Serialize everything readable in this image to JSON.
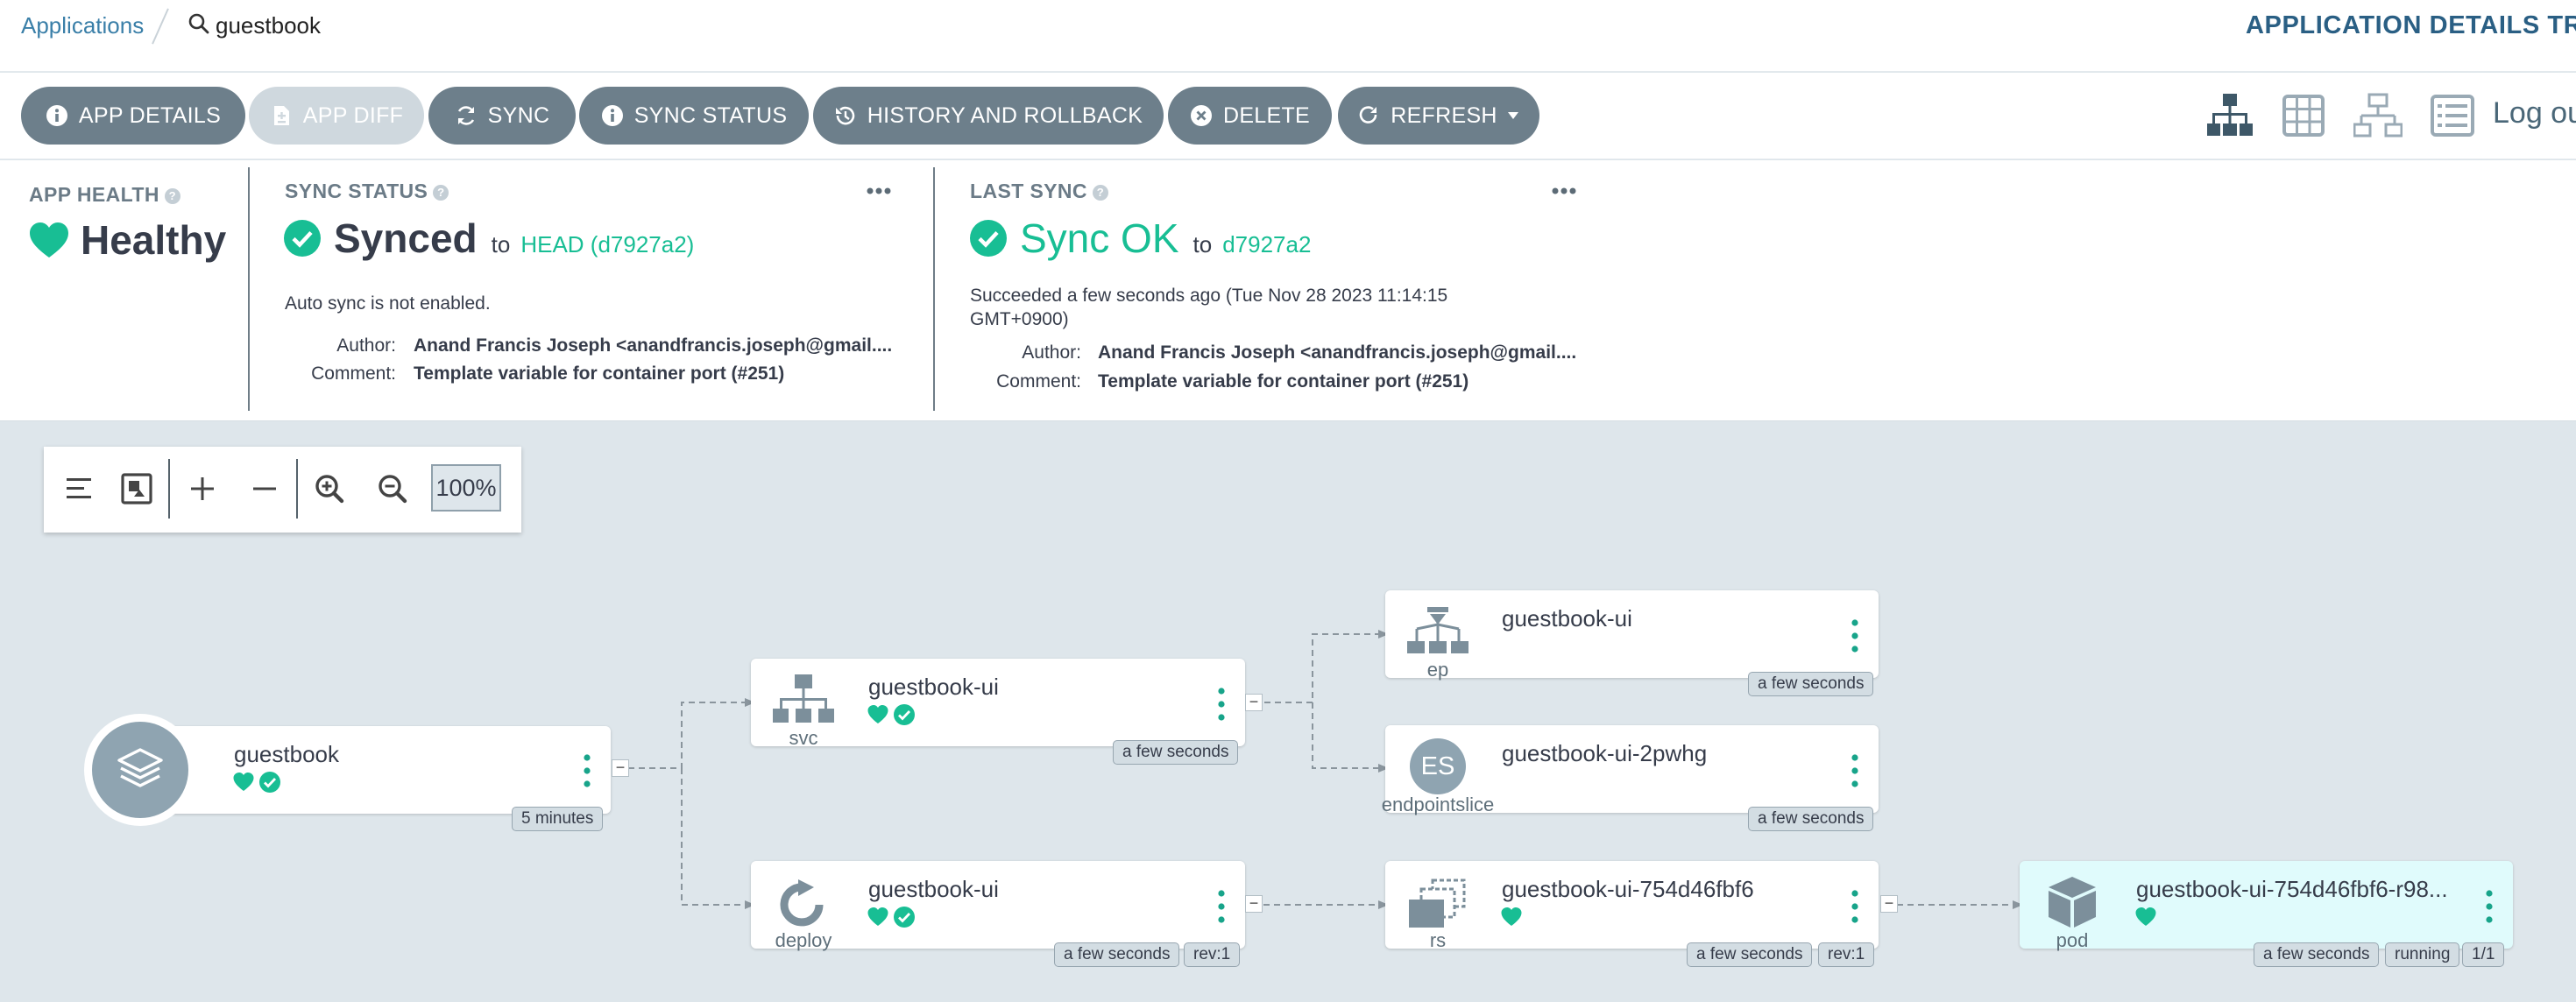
{
  "breadcrumb": {
    "parent": "Applications",
    "current": "guestbook"
  },
  "page_title": "APPLICATION DETAILS TREE",
  "toolbar": {
    "app_details": "APP DETAILS",
    "app_diff": "APP DIFF",
    "sync": "SYNC",
    "sync_status": "SYNC STATUS",
    "history": "HISTORY AND ROLLBACK",
    "delete": "DELETE",
    "refresh": "REFRESH",
    "logout": "Log out",
    "view_icons": [
      "tree-view-icon",
      "pods-grid-view-icon",
      "network-view-icon",
      "list-view-icon"
    ]
  },
  "status": {
    "app_health": {
      "title": "APP HEALTH",
      "value": "Healthy"
    },
    "sync_status": {
      "title": "SYNC STATUS",
      "value": "Synced",
      "to": "to",
      "revision": "HEAD (d7927a2)",
      "auto_sync": "Auto sync is not enabled.",
      "author_label": "Author:",
      "author": "Anand Francis Joseph <anandfrancis.joseph@gmail....",
      "comment_label": "Comment:",
      "comment": "Template variable for container port (#251)"
    },
    "last_sync": {
      "title": "LAST SYNC",
      "value": "Sync OK",
      "to": "to",
      "revision": "d7927a2",
      "succeeded_line1": "Succeeded a few seconds ago (Tue Nov 28 2023 11:14:15",
      "succeeded_line2": "GMT+0900)",
      "author_label": "Author:",
      "author": "Anand Francis Joseph <anandfrancis.joseph@gmail....",
      "comment_label": "Comment:",
      "comment": "Template variable for container port (#251)"
    }
  },
  "graph_toolbar": {
    "zoom": "100%"
  },
  "colors": {
    "healthy": "#18be94",
    "synced": "#18be94",
    "link": "#18be94",
    "button": "#6d7f8b",
    "title": "#2a5f84"
  },
  "nodes": {
    "app": {
      "name": "guestbook",
      "tags": [
        "5 minutes"
      ]
    },
    "svc": {
      "name": "guestbook-ui",
      "kind": "svc",
      "tags": [
        "a few seconds"
      ]
    },
    "deploy": {
      "name": "guestbook-ui",
      "kind": "deploy",
      "tags": [
        "a few seconds",
        "rev:1"
      ]
    },
    "ep": {
      "name": "guestbook-ui",
      "kind": "ep",
      "tags": [
        "a few seconds"
      ]
    },
    "endpointslice": {
      "name": "guestbook-ui-2pwhg",
      "kind": "endpointslice",
      "icon_text": "ES",
      "tags": [
        "a few seconds"
      ]
    },
    "rs": {
      "name": "guestbook-ui-754d46fbf6",
      "kind": "rs",
      "tags": [
        "a few seconds",
        "rev:1"
      ]
    },
    "pod": {
      "name": "guestbook-ui-754d46fbf6-r98...",
      "kind": "pod",
      "tags": [
        "a few seconds",
        "running",
        "1/1"
      ]
    }
  }
}
